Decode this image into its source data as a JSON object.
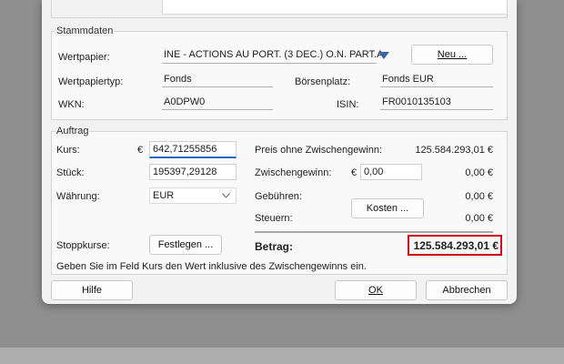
{
  "stammdaten": {
    "legend": "Stammdaten",
    "wertpapier_label": "Wertpapier:",
    "wertpapier_value": "INE - ACTIONS AU PORT. (3 DEC.) O.N. PART.A",
    "neu_button": "Neu ...",
    "wertpapiertyp_label": "Wertpapiertyp:",
    "wertpapiertyp_value": "Fonds",
    "boersenplatz_label": "Börsenplatz:",
    "boersenplatz_value": "Fonds EUR",
    "wkn_label": "WKN:",
    "wkn_value": "A0DPW0",
    "isin_label": "ISIN:",
    "isin_value": "FR0010135103"
  },
  "auftrag": {
    "legend": "Auftrag",
    "kurs_label": "Kurs:",
    "kurs_currency": "€",
    "kurs_value": "642,71255856",
    "stueck_label": "Stück:",
    "stueck_value": "195397,29128",
    "waehrung_label": "Währung:",
    "waehrung_value": "EUR",
    "stoppkurse_label": "Stoppkurse:",
    "festlegen_button": "Festlegen ...",
    "preis_label": "Preis ohne Zwischengewinn:",
    "preis_value": "125.584.293,01 €",
    "zwischengewinn_label": "Zwischengewinn:",
    "zwischengewinn_currency": "€",
    "zwischengewinn_input": "0,00",
    "zwischengewinn_value": "0,00 €",
    "gebuehren_label": "Gebühren:",
    "gebuehren_value": "0,00 €",
    "kosten_button": "Kosten ...",
    "steuern_label": "Steuern:",
    "steuern_value": "0,00 €",
    "betrag_label": "Betrag:",
    "betrag_value": "125.584.293,01 €"
  },
  "hint": "Geben Sie im Feld Kurs den Wert inklusive des Zwischengewinns ein.",
  "footer": {
    "hilfe": "Hilfe",
    "ok": "OK",
    "abbrechen": "Abbrechen"
  },
  "colors": {
    "highlight_border": "#d0021b",
    "focus_accent": "#2a64c5",
    "dropdown_arrow": "#3a63a8"
  }
}
